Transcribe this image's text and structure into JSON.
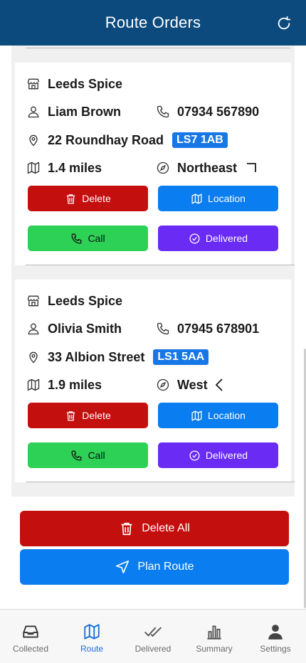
{
  "header": {
    "title": "Route Orders"
  },
  "orders": [
    {
      "shop": "Leeds Spice",
      "customer": "Liam Brown",
      "phone": "07934 567890",
      "address": "22 Roundhay Road",
      "postcode": "LS7 1AB",
      "distance": "1.4 miles",
      "direction": "Northeast",
      "buttons": {
        "delete": "Delete",
        "location": "Location",
        "call": "Call",
        "delivered": "Delivered"
      }
    },
    {
      "shop": "Leeds Spice",
      "customer": "Olivia Smith",
      "phone": "07945 678901",
      "address": "33 Albion Street",
      "postcode": "LS1 5AA",
      "distance": "1.9 miles",
      "direction": "West",
      "buttons": {
        "delete": "Delete",
        "location": "Location",
        "call": "Call",
        "delivered": "Delivered"
      }
    }
  ],
  "actions": {
    "delete_all": "Delete All",
    "plan_route": "Plan Route"
  },
  "tabs": [
    {
      "label": "Collected"
    },
    {
      "label": "Route"
    },
    {
      "label": "Delivered"
    },
    {
      "label": "Summary"
    },
    {
      "label": "Settings"
    }
  ],
  "colors": {
    "header": "#0c4a7e",
    "delete": "#c40f0f",
    "location": "#0a7df0",
    "call": "#2dd155",
    "delivered": "#6a2cf5",
    "active_tab": "#1a6fd4"
  }
}
